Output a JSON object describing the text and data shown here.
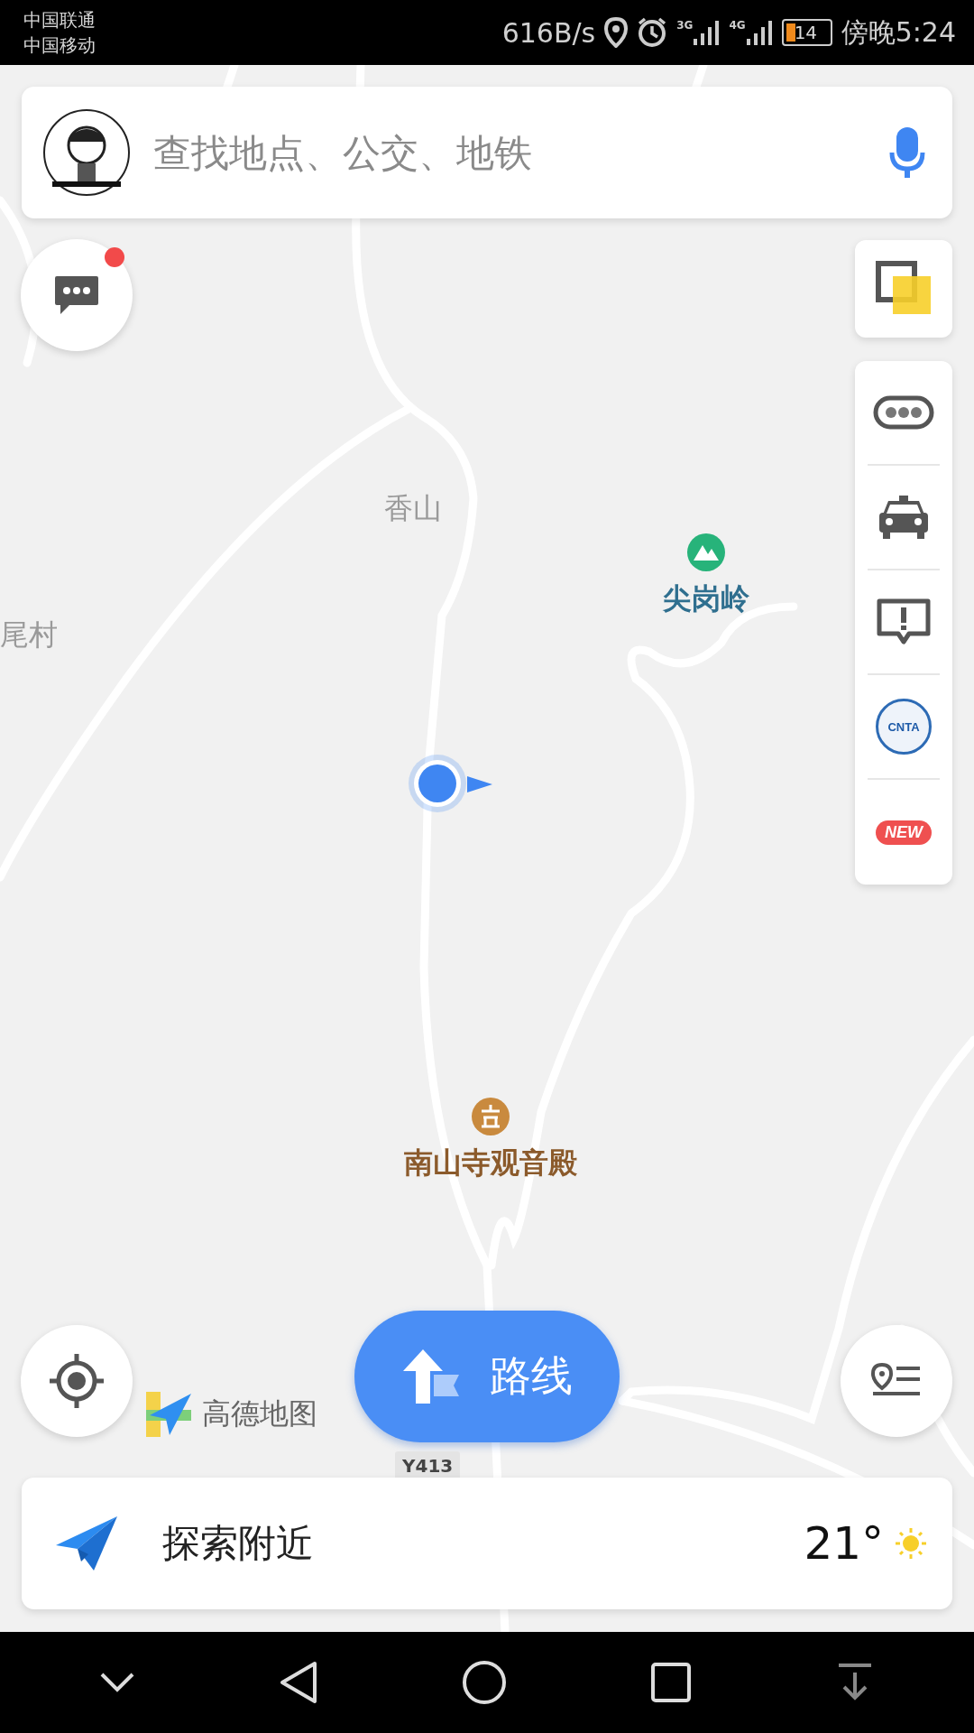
{
  "status_bar": {
    "carriers": [
      "中国联通",
      "中国移动"
    ],
    "speed": "616B/s",
    "network_1": "3G",
    "network_2": "4G",
    "battery": "14",
    "time": "傍晚5:24"
  },
  "search": {
    "placeholder": "查找地点、公交、地铁"
  },
  "messages": {
    "unread": true
  },
  "map": {
    "labels": [
      {
        "text": "香山",
        "kind": "area"
      },
      {
        "text": "尾村",
        "kind": "area"
      },
      {
        "text": "尖岗岭",
        "kind": "mountain",
        "color": "#2f6f8f"
      },
      {
        "text": "南山寺观音殿",
        "kind": "temple",
        "color": "#8b5a2b"
      }
    ],
    "road_label": "Y413",
    "logo": "高德地图"
  },
  "toolbar": [
    {
      "kind": "traffic"
    },
    {
      "kind": "taxi"
    },
    {
      "kind": "report"
    },
    {
      "kind": "cnta",
      "text": "CNTA"
    },
    {
      "kind": "new",
      "text": "NEW"
    }
  ],
  "route_button": {
    "label": "路线"
  },
  "explore": {
    "label": "探索附近",
    "temperature": "21°"
  }
}
